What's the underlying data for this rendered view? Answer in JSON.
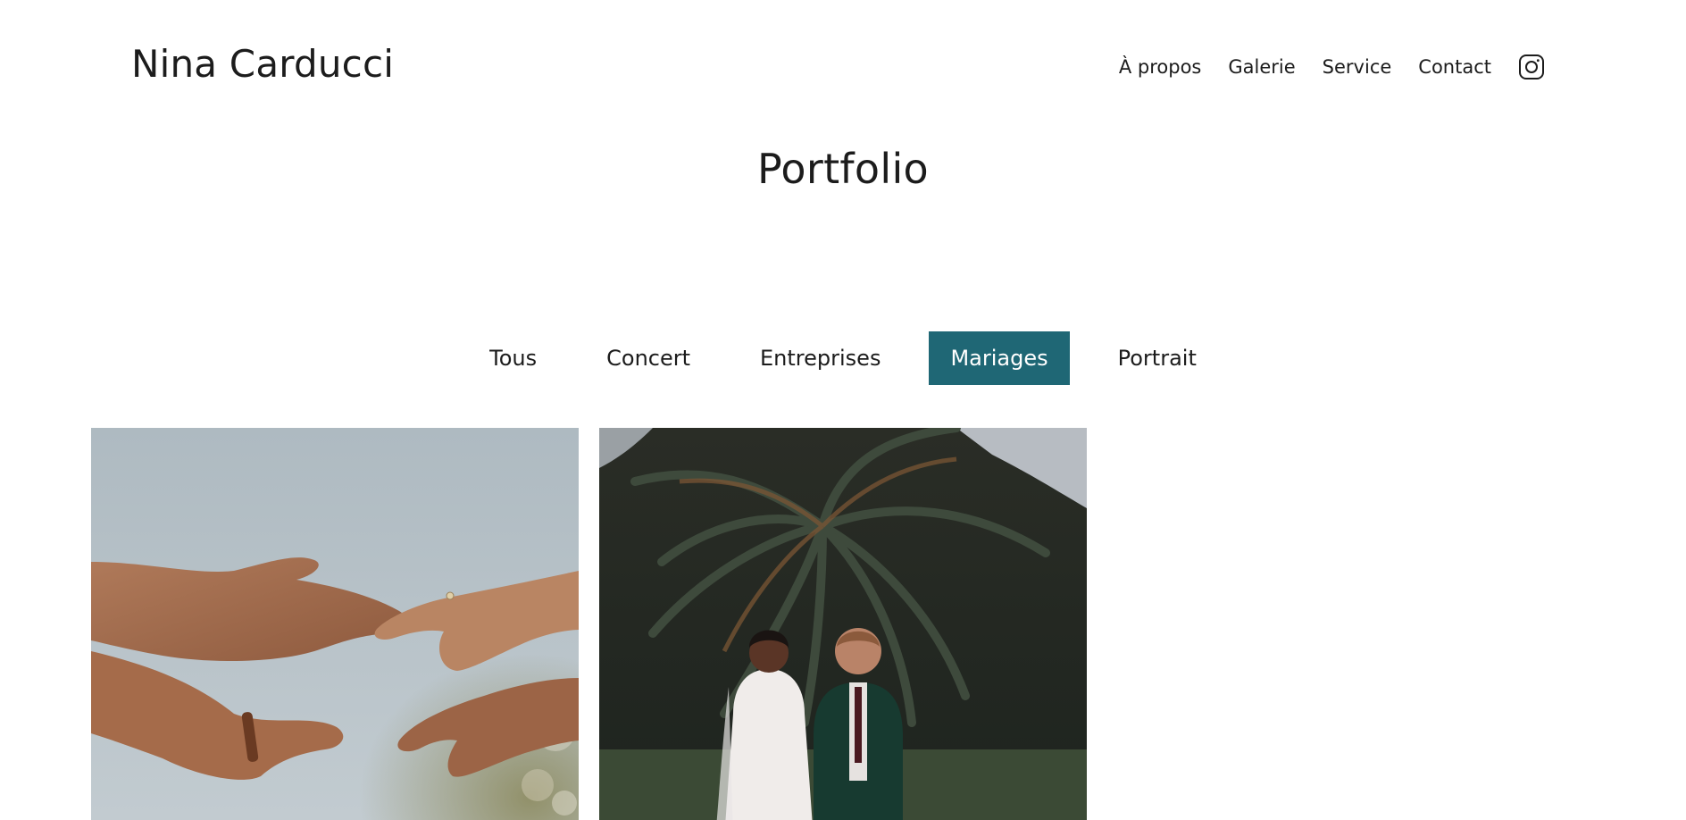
{
  "header": {
    "site_title": "Nina Carducci",
    "nav": [
      {
        "label": "À propos"
      },
      {
        "label": "Galerie"
      },
      {
        "label": "Service"
      },
      {
        "label": "Contact"
      }
    ],
    "social_icon": "instagram-icon"
  },
  "portfolio": {
    "title": "Portfolio",
    "filters": [
      {
        "label": "Tous",
        "active": false
      },
      {
        "label": "Concert",
        "active": false
      },
      {
        "label": "Entreprises",
        "active": false
      },
      {
        "label": "Mariages",
        "active": true
      },
      {
        "label": "Portrait",
        "active": false
      }
    ],
    "active_filter_color": "#1f6775",
    "gallery": [
      {
        "subject": "hands-with-ring-photo"
      },
      {
        "subject": "wedding-couple-under-palm-photo"
      }
    ]
  }
}
